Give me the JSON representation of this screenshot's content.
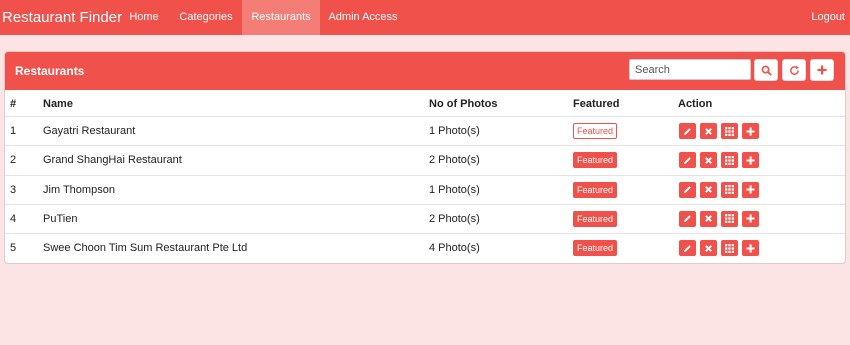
{
  "navbar": {
    "brand": "Restaurant Finder",
    "items": [
      {
        "label": "Home",
        "active": false
      },
      {
        "label": "Categories",
        "active": false
      },
      {
        "label": "Restaurants",
        "active": true
      },
      {
        "label": "Admin Access",
        "active": false
      }
    ],
    "logout_label": "Logout"
  },
  "panel": {
    "title": "Restaurants",
    "search": {
      "placeholder": "Search",
      "value": ""
    },
    "buttons": [
      {
        "icon": "search-icon"
      },
      {
        "icon": "refresh-icon"
      },
      {
        "icon": "plus-icon"
      }
    ]
  },
  "table": {
    "columns": [
      "#",
      "Name",
      "No of Photos",
      "Featured",
      "Action"
    ],
    "rows": [
      {
        "num": "1",
        "name": "Gayatri Restaurant",
        "photos": "1 Photo(s)",
        "featured": "Featured",
        "featured_style": "outline"
      },
      {
        "num": "2",
        "name": "Grand ShangHai Restaurant",
        "photos": "2 Photo(s)",
        "featured": "Featured",
        "featured_style": "filled"
      },
      {
        "num": "3",
        "name": "Jim Thompson",
        "photos": "1 Photo(s)",
        "featured": "Featured",
        "featured_style": "filled"
      },
      {
        "num": "4",
        "name": "PuTien",
        "photos": "2 Photo(s)",
        "featured": "Featured",
        "featured_style": "filled"
      },
      {
        "num": "5",
        "name": "Swee Choon Tim Sum Restaurant Pte Ltd",
        "photos": "4 Photo(s)",
        "featured": "Featured",
        "featured_style": "filled"
      }
    ],
    "row_actions": [
      "edit-icon",
      "delete-icon",
      "grid-icon",
      "plus-icon"
    ]
  },
  "colors": {
    "accent": "#f1514b",
    "nav_active": "#f47d78",
    "page_background": "#fde4e4"
  }
}
